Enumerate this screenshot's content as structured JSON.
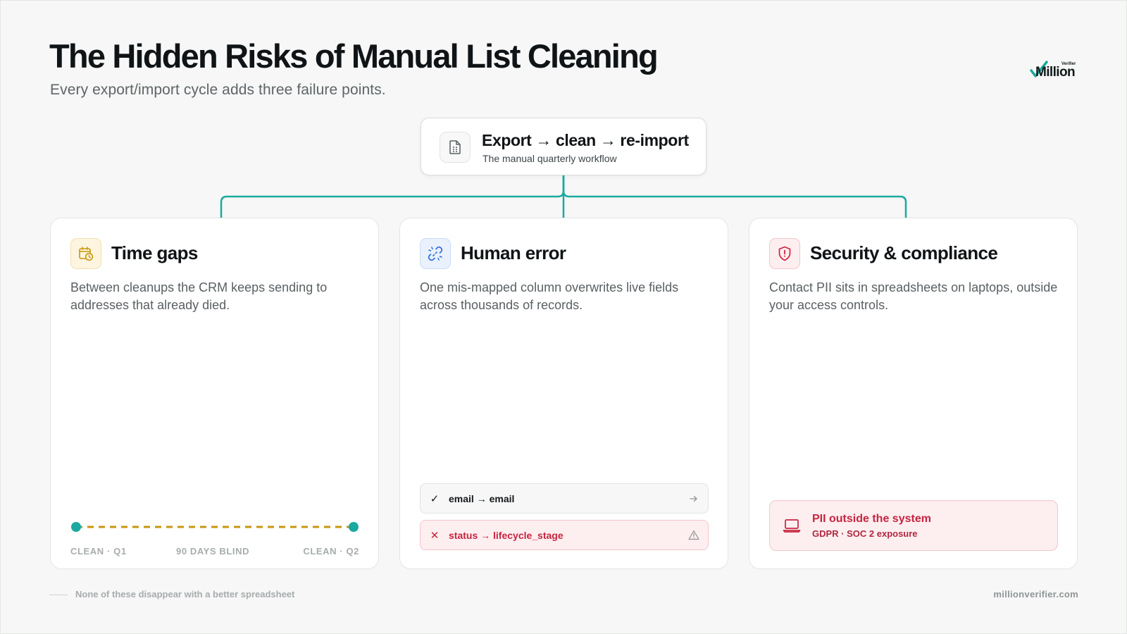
{
  "header": {
    "title": "The Hidden Risks of Manual List Cleaning",
    "subtitle": "Every export/import cycle adds three failure points."
  },
  "logo": {
    "word": "Million",
    "tag": "Verifier"
  },
  "root": {
    "title": "Export → clean → re-import",
    "subtitle": "The manual quarterly workflow",
    "icon": "spreadsheet-file-icon"
  },
  "cards": [
    {
      "title": "Time gaps",
      "description": "Between cleanups the CRM keeps sending to addresses that already died.",
      "icon": "calendar-clock-icon",
      "accent": "#c8960f",
      "timeline": {
        "start_label": "CLEAN · Q1",
        "middle_label": "90 DAYS BLIND",
        "end_label": "CLEAN · Q2"
      }
    },
    {
      "title": "Human error",
      "description": "One mis-mapped column overwrites live fields across thousands of records.",
      "icon": "broken-link-icon",
      "accent": "#2f6fd6",
      "mappings": [
        {
          "text": "email → email",
          "status": "ok",
          "mark": "✓",
          "end_icon": "arrow-right-icon"
        },
        {
          "text": "status → lifecycle_stage",
          "status": "error",
          "mark": "✕",
          "end_icon": "warning-icon"
        }
      ]
    },
    {
      "title": "Security & compliance",
      "description": "Contact PII sits in spreadsheets on laptops, outside your access controls.",
      "icon": "shield-alert-icon",
      "accent": "#d0233f",
      "alert": {
        "title": "PII outside the system",
        "subtitle": "GDPR · SOC 2 exposure",
        "icon": "laptop-icon"
      }
    }
  ],
  "footer": {
    "note": "None of these disappear with a better spreadsheet",
    "url": "millionverifier.com"
  },
  "colors": {
    "background": "#f6f7f6",
    "connector": "#1aa9a0",
    "timeline_dash": "#c8960f",
    "timeline_dot": "#1aa9a0",
    "error": "#c6253f"
  }
}
